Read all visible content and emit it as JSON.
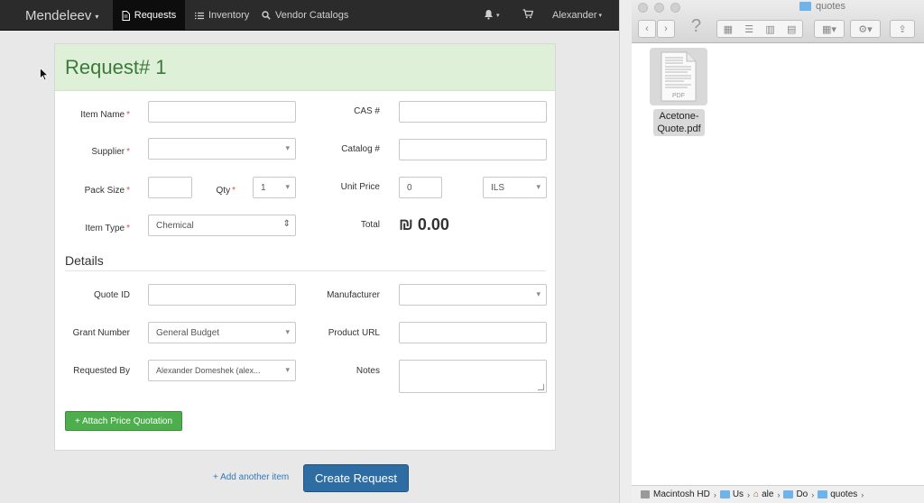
{
  "navbar": {
    "brand": "Mendeleev",
    "tabs": [
      {
        "label": "Requests",
        "icon": "file-icon",
        "active": true
      },
      {
        "label": "Inventory",
        "icon": "list-icon",
        "active": false
      },
      {
        "label": "Vendor Catalogs",
        "icon": "search-icon",
        "active": false
      }
    ],
    "user": "Alexander"
  },
  "form": {
    "title": "Request# 1",
    "fields": {
      "item_name": {
        "label": "Item Name",
        "value": ""
      },
      "supplier": {
        "label": "Supplier",
        "value": ""
      },
      "pack_size": {
        "label": "Pack Size",
        "value": ""
      },
      "qty": {
        "label": "Qty",
        "value": "1"
      },
      "item_type": {
        "label": "Item Type",
        "value": "Chemical"
      },
      "cas": {
        "label": "CAS #",
        "value": ""
      },
      "catalog": {
        "label": "Catalog #",
        "value": ""
      },
      "unit_price": {
        "label": "Unit Price",
        "value": "0"
      },
      "currency": {
        "value": "ILS"
      },
      "total": {
        "label": "Total",
        "value": "₪ 0.00"
      }
    },
    "details_heading": "Details",
    "details": {
      "quote_id": {
        "label": "Quote ID",
        "value": ""
      },
      "grant_number": {
        "label": "Grant Number",
        "value": "General Budget"
      },
      "requested_by": {
        "label": "Requested By",
        "value": "Alexander Domeshek (alex..."
      },
      "manufacturer": {
        "label": "Manufacturer",
        "value": ""
      },
      "product_url": {
        "label": "Product URL",
        "value": ""
      },
      "notes": {
        "label": "Notes",
        "value": ""
      }
    },
    "attach_button": "+ Attach Price Quotation",
    "add_item_link": "+ Add another item",
    "create_button": "Create Request"
  },
  "finder": {
    "title": "quotes",
    "file": {
      "name": "Acetone-\nQuote.pdf",
      "line1": "Acetone-",
      "line2": "Quote.pdf",
      "badge": "PDF"
    },
    "path": [
      {
        "label": "Macintosh HD",
        "icon": "hard-drive-icon"
      },
      {
        "label": "Us",
        "icon": "folder-icon"
      },
      {
        "label": "ale",
        "icon": "home-icon"
      },
      {
        "label": "Do",
        "icon": "folder-icon"
      },
      {
        "label": "quotes",
        "icon": "folder-icon"
      }
    ]
  },
  "colors": {
    "navbar_bg": "#2b2b2b",
    "header_green": "#dff0d8",
    "title_green": "#3c7a3c",
    "required_red": "#d9534f",
    "attach_green": "#4cae4c",
    "primary_blue": "#2e6da4",
    "link_blue": "#337ab7"
  }
}
